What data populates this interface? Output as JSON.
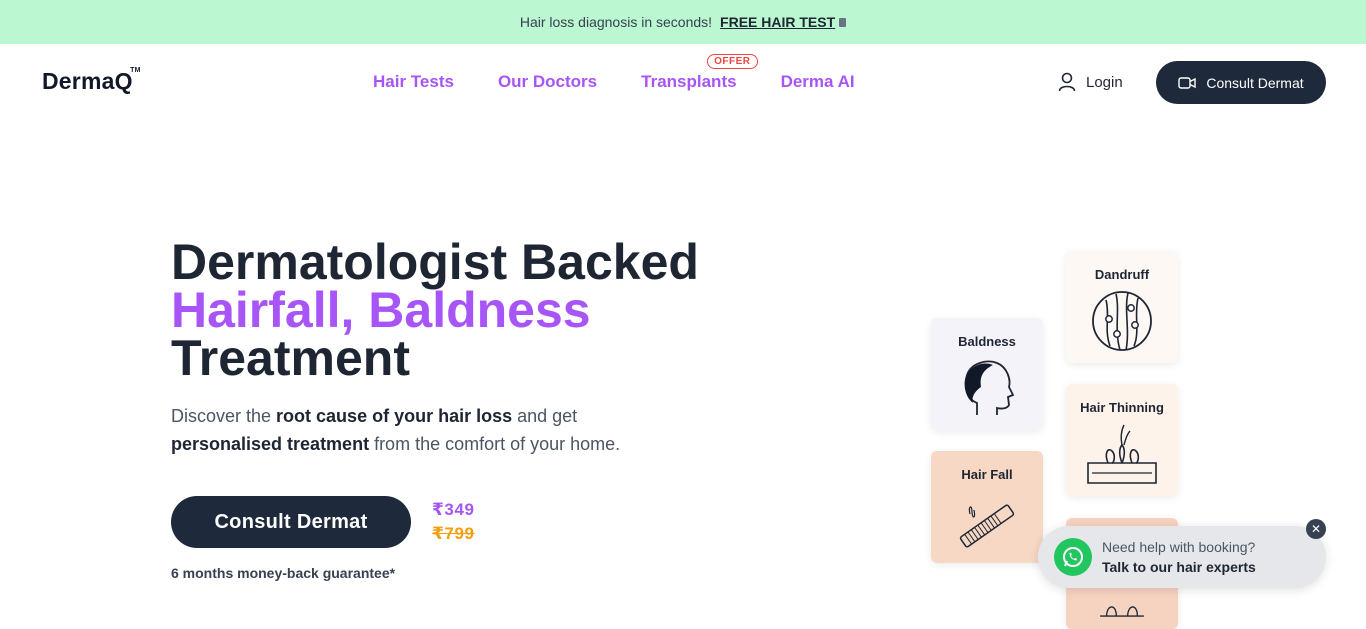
{
  "topbar": {
    "text": "Hair loss diagnosis in seconds!",
    "link": "FREE HAIR TEST"
  },
  "header": {
    "logo": "DermaQ",
    "logo_tm": "TM",
    "nav": [
      {
        "label": "Hair Tests"
      },
      {
        "label": "Our Doctors"
      },
      {
        "label": "Transplants",
        "badge": "OFFER"
      },
      {
        "label": "Derma AI"
      }
    ],
    "login": "Login",
    "consult": "Consult Dermat"
  },
  "hero": {
    "title_line1": "Dermatologist Backed",
    "title_line2": "Hairfall, Baldness",
    "title_line3": "Treatment",
    "sub_pre1": "Discover the ",
    "sub_bold1": "root cause of your hair loss",
    "sub_post1": " and get",
    "sub_bold2": "personalised treatment",
    "sub_post2": " from the comfort of your home.",
    "cta": "Consult Dermat",
    "price_new": "₹349",
    "price_old": "₹799",
    "guarantee": "6 months money-back guarantee*"
  },
  "cards": [
    {
      "title": "Dandruff",
      "icon": "dandruff-scalp-icon"
    },
    {
      "title": "Baldness",
      "icon": "bald-head-icon"
    },
    {
      "title": "Hair Thinning",
      "icon": "hair-follicle-icon"
    },
    {
      "title": "Hair Fall",
      "icon": "comb-icon"
    }
  ],
  "chat": {
    "line1": "Need help with booking?",
    "line2": "Talk to our hair experts"
  },
  "colors": {
    "accent": "#a855f7",
    "dark": "#1e293b",
    "topbar": "#bbf7d0",
    "whatsapp": "#22c55e"
  }
}
